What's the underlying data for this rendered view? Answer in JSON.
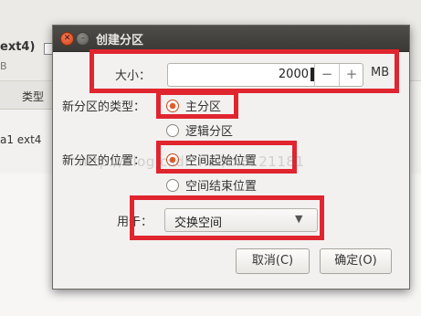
{
  "background_app": {
    "partition_title": "ext4)",
    "partition_sub": "B",
    "column_type": "类型",
    "row_text": "a1  ext4"
  },
  "dialog": {
    "title": "创建分区",
    "size_label": "大小：",
    "size_value": "2000",
    "size_unit": "MB",
    "spin_minus": "−",
    "spin_plus": "+",
    "type_label": "新分区的类型：",
    "type_options": [
      "主分区",
      "逻辑分区"
    ],
    "type_selected": "主分区",
    "location_label": "新分区的位置：",
    "location_options": [
      "空间起始位置",
      "空间结束位置"
    ],
    "location_selected": "空间起始位置",
    "use_label": "用于：",
    "use_value": "交换空间",
    "cancel_label": "取消(C)",
    "ok_label": "确定(O)"
  },
  "watermark": "http://blog.csdn.net/lx8121181",
  "colors": {
    "highlight": "#e0252f",
    "titlebar": "#3c3b37",
    "radio_selected": "#e05c2a"
  },
  "icons": {
    "close": "close-icon",
    "minimize": "minimize-icon",
    "dropdown": "chevron-down-icon"
  }
}
